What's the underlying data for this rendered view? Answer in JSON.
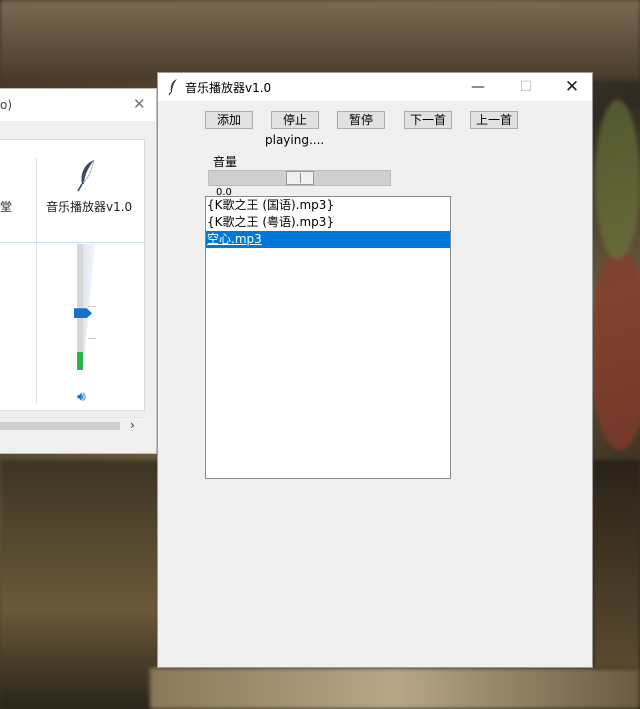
{
  "mixer": {
    "title": "o)",
    "left_label": "堂",
    "app_label": "音乐播放器v1.0",
    "volume_level": 0.45
  },
  "window": {
    "title": "音乐播放器v1.0",
    "minimize_icon": "—",
    "maximize_icon": "☐",
    "close_icon": "✕"
  },
  "toolbar": {
    "add_label": "添加",
    "stop_label": "停止",
    "pause_label": "暂停",
    "next_label": "下一首",
    "prev_label": "上一首"
  },
  "status": {
    "text": "playing...."
  },
  "volume": {
    "label": "音量",
    "value_text": "0.0",
    "value": 0.5
  },
  "playlist": {
    "items": [
      "{K歌之王 (国语).mp3}",
      "{K歌之王 (粤语).mp3}",
      "空心.mp3"
    ],
    "selected_index": 2
  },
  "colors": {
    "selection": "#0078d7",
    "mixer_accent": "#1470c8",
    "mixer_level": "#2db14a"
  }
}
